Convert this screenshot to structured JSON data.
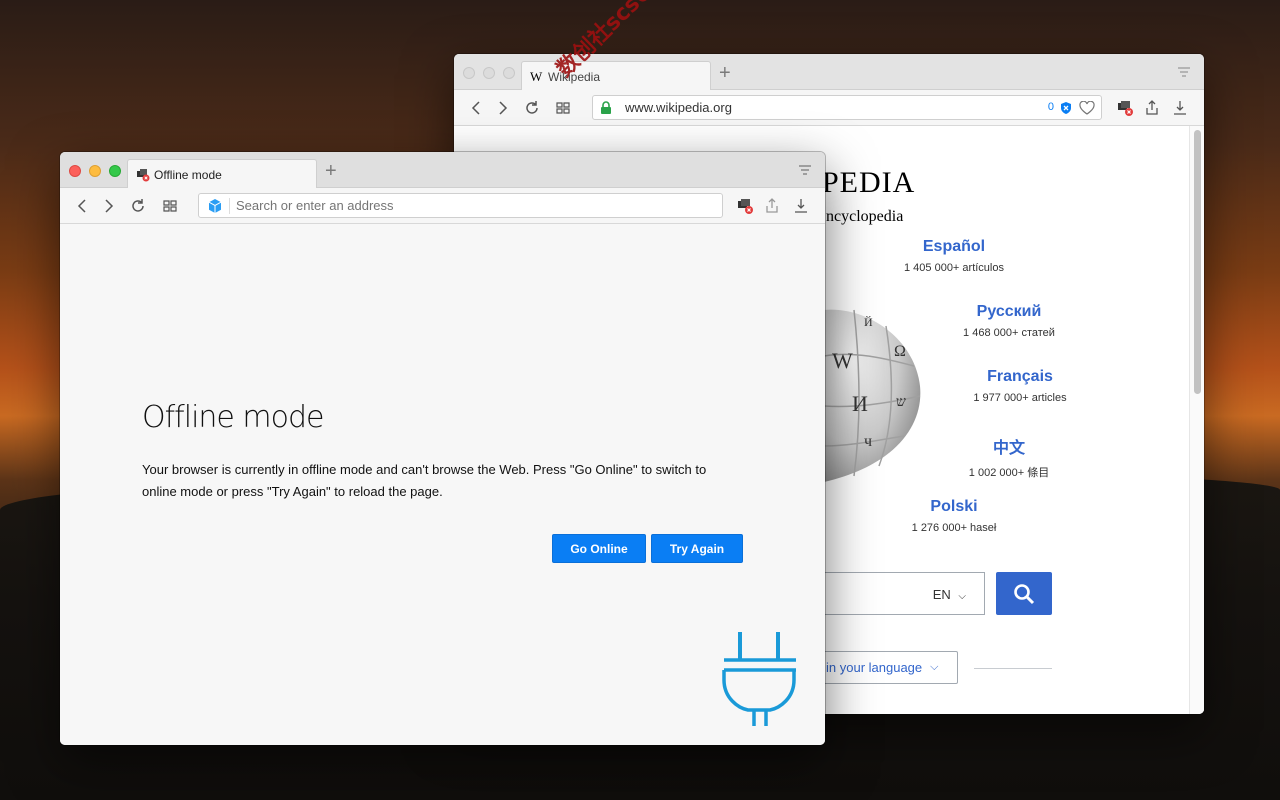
{
  "back_window": {
    "tab_title": "Wikipedia",
    "url": "www.wikipedia.org",
    "privacy_count": "0",
    "wiki_logo_partial": "PEDIA",
    "tagline_partial": "ncyclopedia",
    "languages": [
      {
        "name": "Español",
        "count": "1 405 000+ artículos"
      },
      {
        "name": "Русский",
        "count": "1 468 000+ статей"
      },
      {
        "name": "Français",
        "count": "1 977 000+ articles"
      },
      {
        "name": "中文",
        "count": "1 002 000+ 條目"
      },
      {
        "name": "Polski",
        "count": "1 276 000+ haseł"
      }
    ],
    "search_lang": "EN",
    "read_language_partial": "in your language"
  },
  "front_window": {
    "tab_title": "Offline mode",
    "address_placeholder": "Search or enter an address",
    "heading": "Offline mode",
    "message": "Your browser is currently in offline mode and can't browse the Web. Press \"Go Online\" to switch to online mode or press \"Try Again\" to reload the page.",
    "go_online_label": "Go Online",
    "try_again_label": "Try Again"
  },
  "watermark": "数创社scs66",
  "colors": {
    "accent_button": "#0a7ef4",
    "plug_icon": "#1a9ad8",
    "wiki_link": "#3366cc",
    "wiki_search_button": "#3366cc",
    "traffic_red": "#fc605b",
    "traffic_yellow": "#fdbc40",
    "traffic_green": "#34c84a"
  }
}
